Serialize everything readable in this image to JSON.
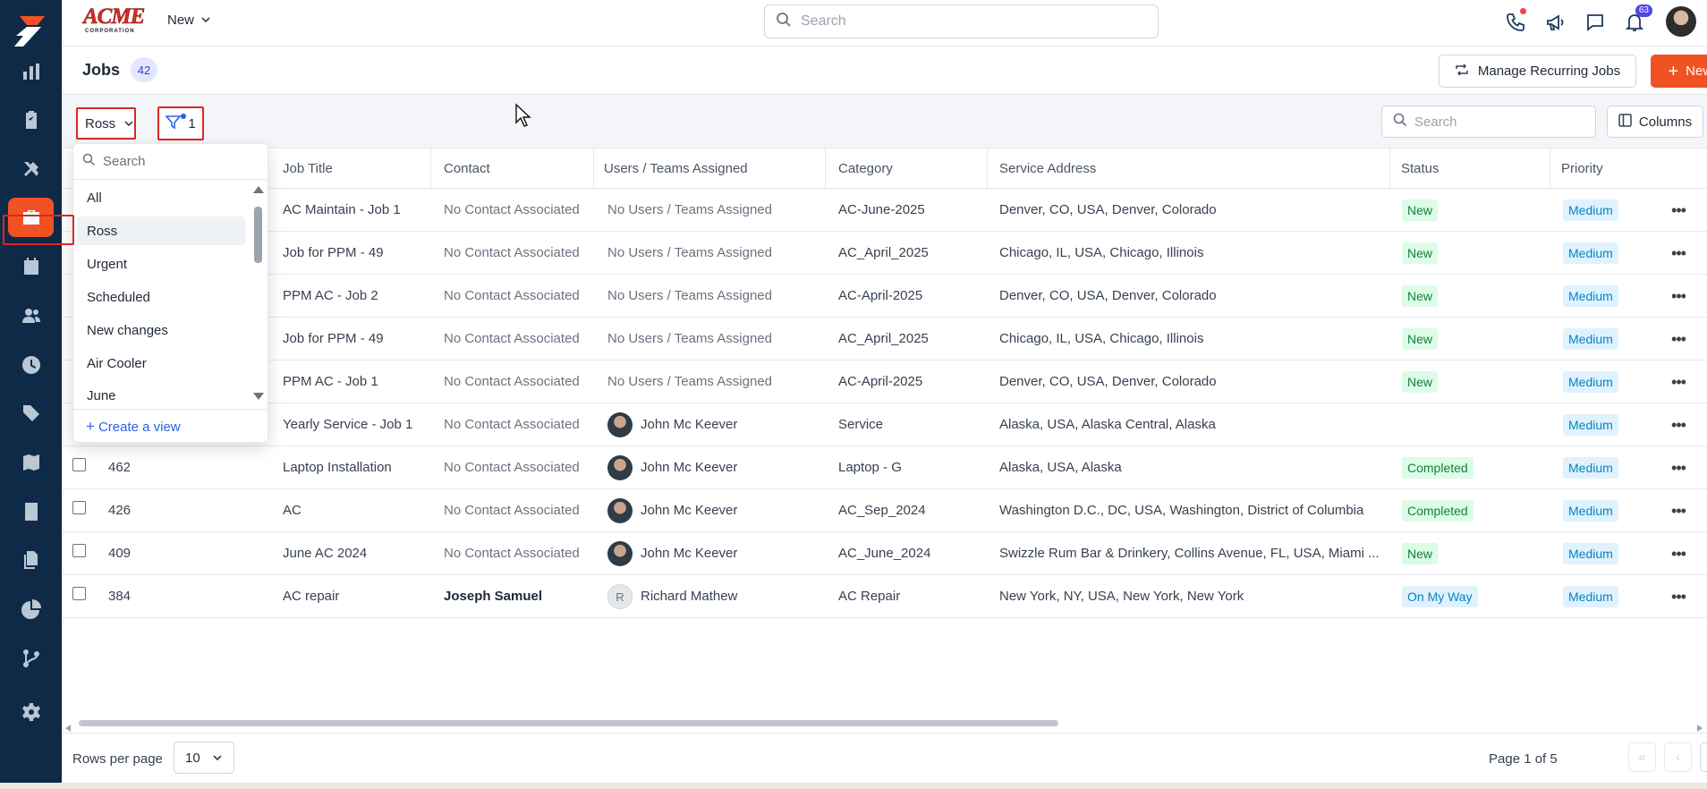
{
  "app": {
    "brand_line1": "ACME",
    "brand_line2": "CORPORATION",
    "new_menu": "New",
    "search_placeholder": "Search",
    "notification_count": "63"
  },
  "sidebar": {
    "items": [
      {
        "icon": "bar-chart-icon"
      },
      {
        "icon": "clipboard-icon"
      },
      {
        "icon": "tools-icon"
      },
      {
        "icon": "briefcase-icon",
        "active": true
      },
      {
        "icon": "calendar-icon"
      },
      {
        "icon": "users-icon"
      },
      {
        "icon": "clock-icon"
      },
      {
        "icon": "tag-icon"
      },
      {
        "icon": "map-icon"
      },
      {
        "icon": "calculator-icon"
      },
      {
        "icon": "documents-icon"
      },
      {
        "icon": "pie-chart-icon"
      },
      {
        "icon": "workflow-icon"
      },
      {
        "icon": "settings-icon"
      }
    ]
  },
  "header": {
    "title": "Jobs",
    "count": "42",
    "manage_recurring": "Manage Recurring Jobs",
    "new_job": "New Job"
  },
  "toolbar": {
    "view_selected": "Ross",
    "filter_count": "1",
    "search_placeholder": "Search",
    "columns_label": "Columns"
  },
  "dropdown": {
    "search_placeholder": "Search",
    "items": [
      "All",
      "Ross",
      "Urgent",
      "Scheduled",
      "New changes",
      "Air Cooler",
      "June"
    ],
    "selected": "Ross",
    "create_view": "Create a view"
  },
  "table": {
    "columns": [
      "Job Title",
      "Contact",
      "Users / Teams Assigned",
      "Category",
      "Service Address",
      "Status",
      "Priority"
    ],
    "rows": [
      {
        "id": "",
        "title": "AC Maintain - Job 1",
        "contact": "No Contact Associated",
        "assigned": "No Users / Teams Assigned",
        "category": "AC-June-2025",
        "address": "Denver, CO, USA, Denver, Colorado",
        "status": "New",
        "priority": "Medium"
      },
      {
        "id": "",
        "title": "Job for PPM - 49",
        "contact": "No Contact Associated",
        "assigned": "No Users / Teams Assigned",
        "category": "AC_April_2025",
        "address": "Chicago, IL, USA, Chicago, Illinois",
        "status": "New",
        "priority": "Medium"
      },
      {
        "id": "",
        "title": "PPM AC - Job 2",
        "contact": "No Contact Associated",
        "assigned": "No Users / Teams Assigned",
        "category": "AC-April-2025",
        "address": "Denver, CO, USA, Denver, Colorado",
        "status": "New",
        "priority": "Medium"
      },
      {
        "id": "",
        "title": "Job for PPM - 49",
        "contact": "No Contact Associated",
        "assigned": "No Users / Teams Assigned",
        "category": "AC_April_2025",
        "address": "Chicago, IL, USA, Chicago, Illinois",
        "status": "New",
        "priority": "Medium"
      },
      {
        "id": "",
        "title": "PPM AC - Job 1",
        "contact": "No Contact Associated",
        "assigned": "No Users / Teams Assigned",
        "category": "AC-April-2025",
        "address": "Denver, CO, USA, Denver, Colorado",
        "status": "New",
        "priority": "Medium"
      },
      {
        "id": "",
        "title": "Yearly Service - Job 1",
        "contact": "No Contact Associated",
        "assigned": "John Mc Keever",
        "category": "Service",
        "address": "Alaska, USA, Alaska Central, Alaska",
        "status": "",
        "priority": "Medium"
      },
      {
        "id": "462",
        "title": "Laptop Installation",
        "contact": "No Contact Associated",
        "assigned": "John Mc Keever",
        "category": "Laptop - G",
        "address": "Alaska, USA, Alaska",
        "status": "Completed",
        "priority": "Medium"
      },
      {
        "id": "426",
        "title": "AC",
        "contact": "No Contact Associated",
        "assigned": "John Mc Keever",
        "category": "AC_Sep_2024",
        "address": "Washington D.C., DC, USA, Washington, District of Columbia",
        "status": "Completed",
        "priority": "Medium"
      },
      {
        "id": "409",
        "title": "June AC 2024",
        "contact": "No Contact Associated",
        "assigned": "John Mc Keever",
        "category": "AC_June_2024",
        "address": "Swizzle Rum Bar & Drinkery, Collins Avenue, FL, USA, Miami ...",
        "status": "New",
        "priority": "Medium"
      },
      {
        "id": "384",
        "title": "AC repair",
        "contact": "Joseph Samuel",
        "assigned": "Richard Mathew",
        "assigned_initial": "R",
        "category": "AC Repair",
        "address": "New York, NY, USA, New York, New York",
        "status": "On My Way",
        "priority": "Medium"
      }
    ]
  },
  "footer": {
    "rows_per_page_label": "Rows per page",
    "rows_per_page_value": "10",
    "page_info": "Page 1 of 5"
  }
}
